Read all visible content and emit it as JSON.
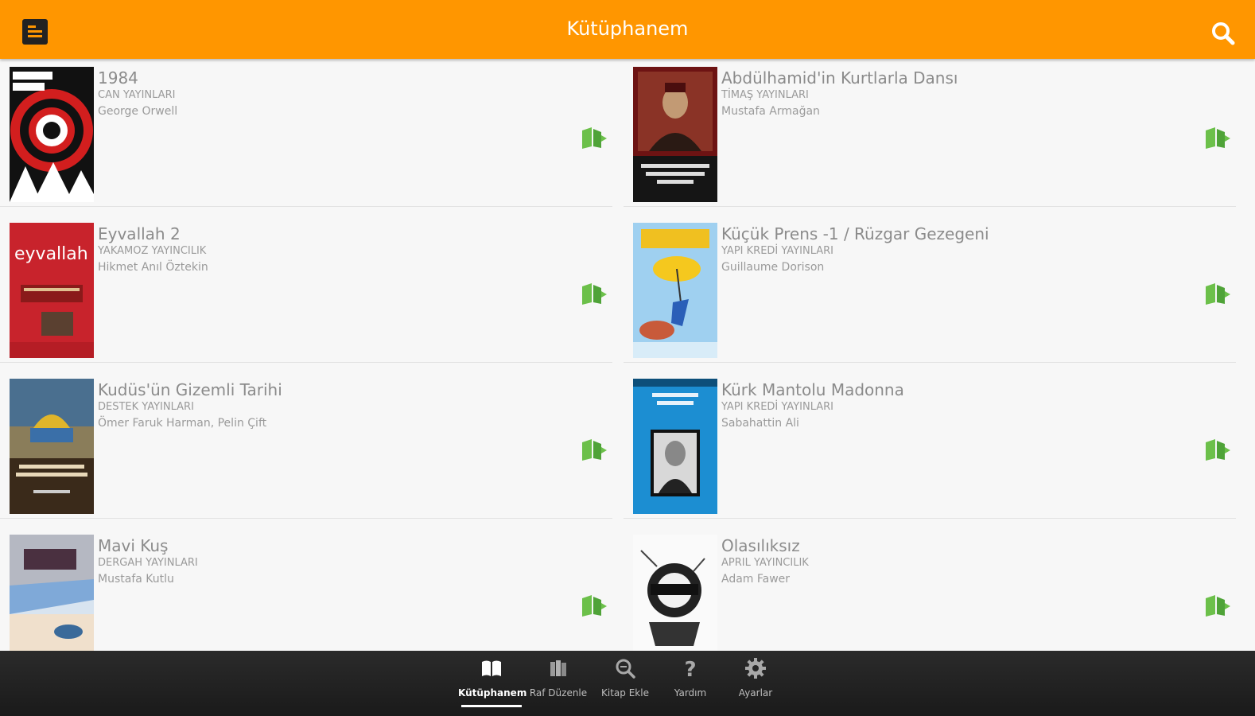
{
  "header": {
    "title": "Kütüphanem",
    "menu_icon": "menu-icon",
    "search_icon": "search-icon"
  },
  "colors": {
    "accent": "#ff9600",
    "bottom_bar": "#222222",
    "book_icon": "#6cc04a"
  },
  "books": [
    {
      "title": "1984",
      "publisher": "CAN YAYINLARI",
      "author": "George Orwell"
    },
    {
      "title": "Abdülhamid'in Kurtlarla Dansı",
      "publisher": "TİMAŞ YAYINLARI",
      "author": "Mustafa Armağan"
    },
    {
      "title": "Eyvallah 2",
      "publisher": "YAKAMOZ YAYINCILIK",
      "author": "Hikmet Anıl Öztekin"
    },
    {
      "title": "Küçük Prens -1 / Rüzgar Gezegeni",
      "publisher": "YAPI KREDİ YAYINLARI",
      "author": "Guillaume Dorison"
    },
    {
      "title": "Kudüs'ün Gizemli Tarihi",
      "publisher": "DESTEK YAYINLARI",
      "author": "Ömer Faruk Harman, Pelin Çift"
    },
    {
      "title": "Kürk Mantolu Madonna",
      "publisher": "YAPI KREDİ YAYINLARI",
      "author": "Sabahattin Ali"
    },
    {
      "title": "Mavi Kuş",
      "publisher": "DERGAH YAYINLARI",
      "author": "Mustafa Kutlu"
    },
    {
      "title": "Olasılıksız",
      "publisher": "APRIL YAYINCILIK",
      "author": "Adam Fawer"
    }
  ],
  "bottom_nav": [
    {
      "label": "Kütüphanem",
      "icon": "open-book-icon",
      "active": true
    },
    {
      "label": "Raf Düzenle",
      "icon": "shelf-books-icon",
      "active": false
    },
    {
      "label": "Kitap Ekle",
      "icon": "magnifier-icon",
      "active": false
    },
    {
      "label": "Yardım",
      "icon": "question-icon",
      "active": false
    },
    {
      "label": "Ayarlar",
      "icon": "gear-icon",
      "active": false
    }
  ]
}
